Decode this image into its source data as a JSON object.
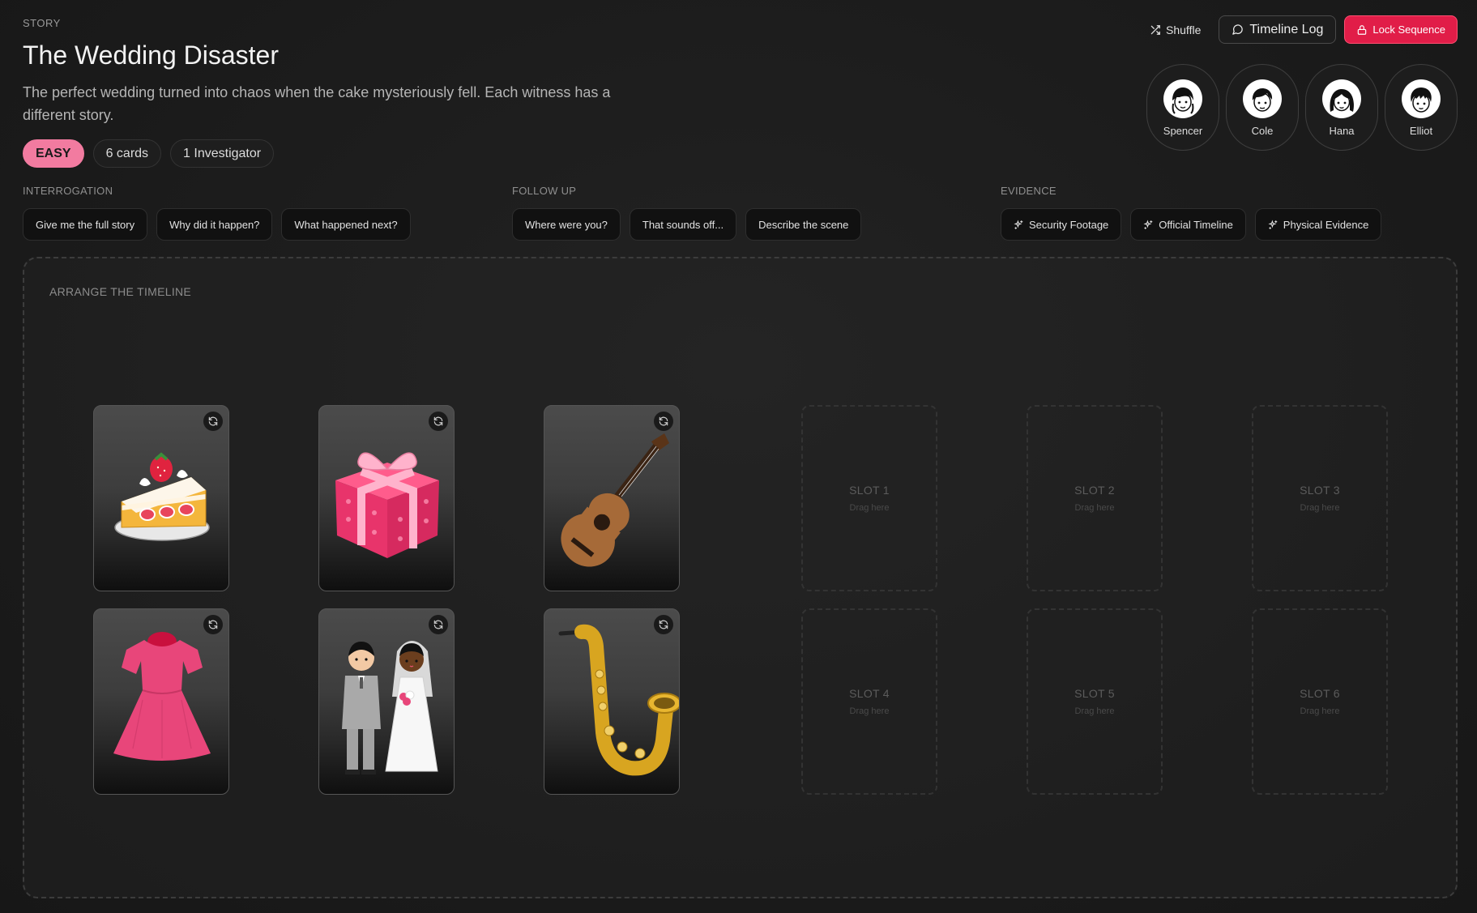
{
  "story": {
    "label": "STORY",
    "title": "The Wedding Disaster",
    "description": "The perfect wedding turned into chaos when the cake mysteriously fell. Each witness has a different story.",
    "difficulty": "EASY",
    "cards": "6 cards",
    "investigators": "1 Investigator"
  },
  "actions": {
    "shuffle": "Shuffle",
    "timeline_log": "Timeline Log",
    "lock_sequence": "Lock Sequence"
  },
  "characters": [
    {
      "name": "Spencer"
    },
    {
      "name": "Cole"
    },
    {
      "name": "Hana"
    },
    {
      "name": "Elliot"
    }
  ],
  "question_groups": [
    {
      "label": "INTERROGATION",
      "questions": [
        "Give me the full story",
        "Why did it happen?",
        "What happened next?"
      ]
    },
    {
      "label": "FOLLOW UP",
      "questions": [
        "Where were you?",
        "That sounds off...",
        "Describe the scene"
      ]
    },
    {
      "label": "EVIDENCE",
      "questions": [
        "Security Footage",
        "Official Timeline",
        "Physical Evidence"
      ]
    }
  ],
  "board": {
    "label": "ARRANGE THE TIMELINE",
    "cards": [
      {
        "item": "cake-slice"
      },
      {
        "item": "gift-box"
      },
      {
        "item": "acoustic-guitar"
      },
      {
        "item": "pink-dress"
      },
      {
        "item": "wedding-couple"
      },
      {
        "item": "saxophone"
      }
    ],
    "slots": [
      {
        "label": "SLOT 1",
        "hint": "Drag here"
      },
      {
        "label": "SLOT 2",
        "hint": "Drag here"
      },
      {
        "label": "SLOT 3",
        "hint": "Drag here"
      },
      {
        "label": "SLOT 4",
        "hint": "Drag here"
      },
      {
        "label": "SLOT 5",
        "hint": "Drag here"
      },
      {
        "label": "SLOT 6",
        "hint": "Drag here"
      }
    ]
  },
  "colors": {
    "accent_pink": "#f27ba0",
    "accent_red": "#e11d48",
    "background": "#1c1c1c"
  }
}
